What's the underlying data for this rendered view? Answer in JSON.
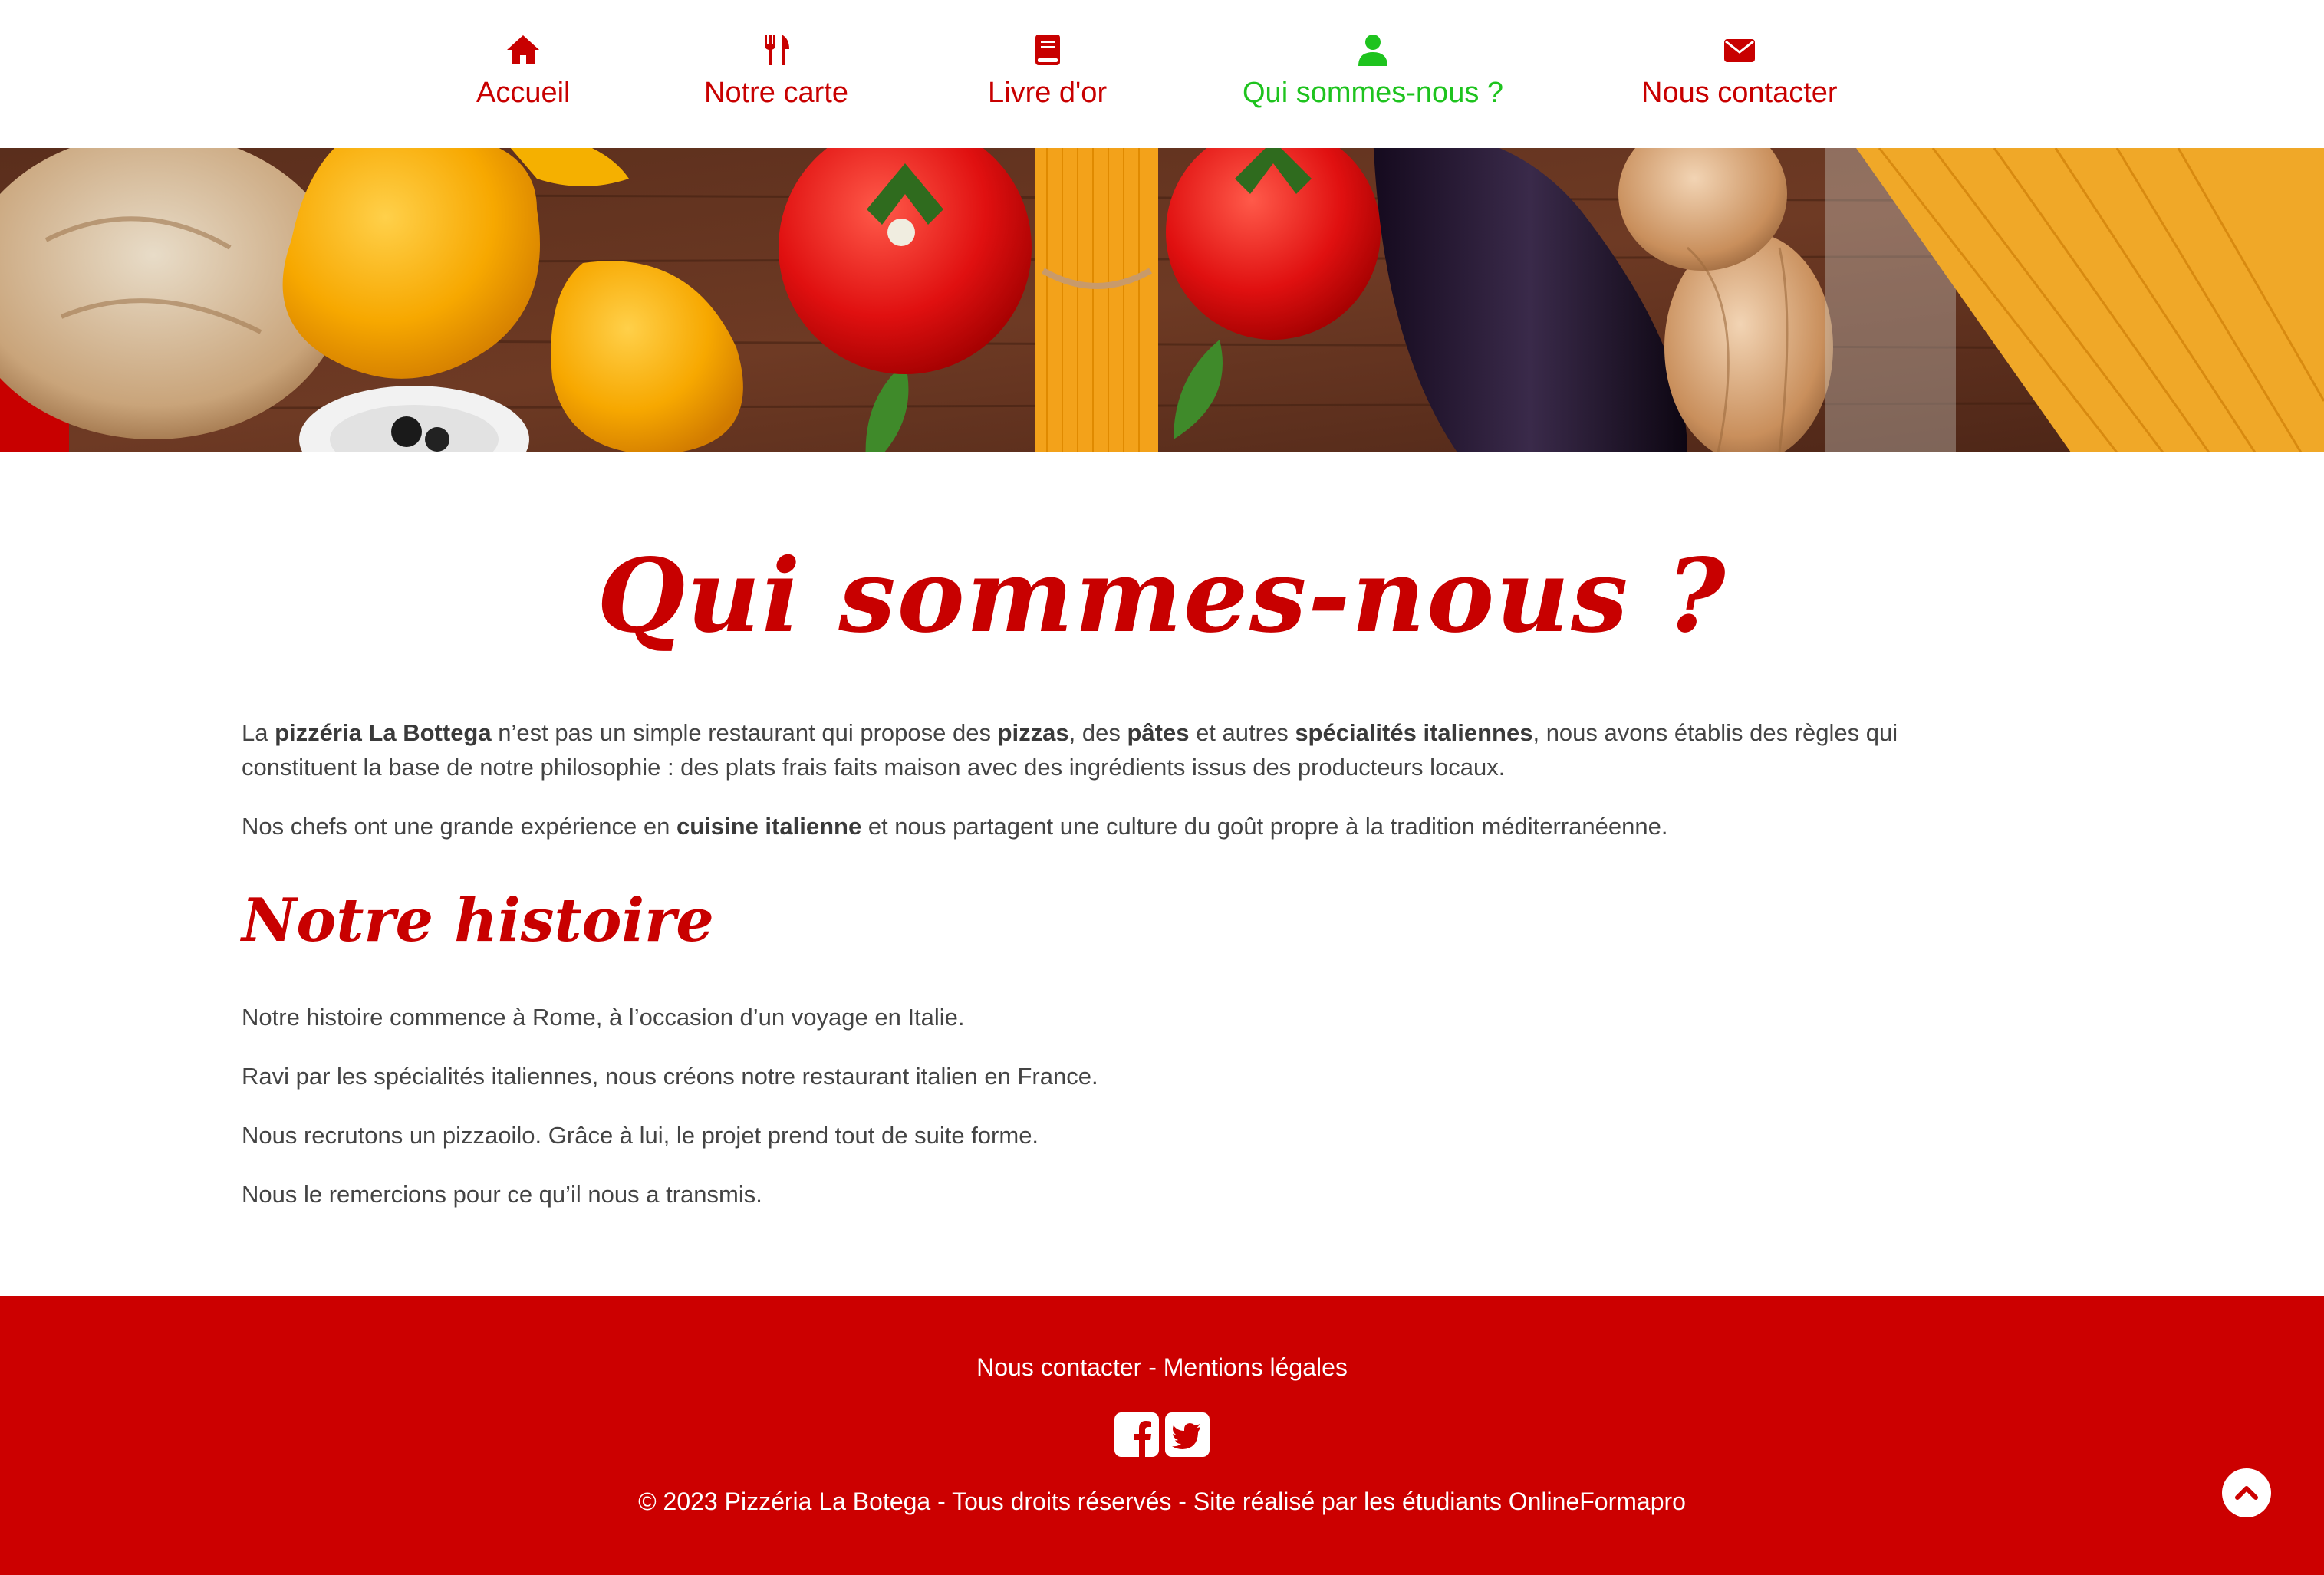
{
  "nav": {
    "items": [
      {
        "label": "Accueil",
        "icon": "home-icon"
      },
      {
        "label": "Notre carte",
        "icon": "utensils-icon"
      },
      {
        "label": "Livre d'or",
        "icon": "book-icon"
      },
      {
        "label": "Qui sommes-nous ?",
        "icon": "user-icon",
        "active": true
      },
      {
        "label": "Nous contacter",
        "icon": "envelope-icon"
      }
    ]
  },
  "main": {
    "title": "Qui sommes-nous ?",
    "intro": {
      "p1": {
        "t1": "La ",
        "b1": "pizzéria La Bottega",
        "t2": " n’est pas un simple restaurant qui propose des ",
        "b2": "pizzas",
        "t3": ", des ",
        "b3": "pâtes",
        "t4": " et autres ",
        "b4": "spécialités italiennes",
        "t5": ", nous avons établis des règles qui constituent la base de notre philosophie : des plats frais faits maison avec des ingrédients issus des producteurs locaux."
      },
      "p2": {
        "t1": "Nos chefs ont une grande expérience en ",
        "b1": "cuisine italienne",
        "t2": " et nous partagent une culture du goût propre à la tradition méditerranéenne."
      }
    },
    "history_title": "Notre histoire",
    "history": [
      "Notre histoire commence à Rome, à l’occasion d’un voyage en Italie.",
      "Ravi par les spécialités italiennes, nous créons notre restaurant italien en France.",
      "Nous recrutons un pizzaoilo. Grâce à lui, le projet prend tout de suite forme.",
      "Nous le remercions pour ce qu’il nous a transmis."
    ]
  },
  "footer": {
    "contact_link": "Nous contacter",
    "separator": " - ",
    "legal_link": "Mentions légales",
    "socials": [
      "facebook-icon",
      "twitter-icon"
    ],
    "copyright": "© 2023 Pizzéria La Botega - Tous droits réservés - Site réalisé par les étudiants OnlineFormapro"
  },
  "colors": {
    "brand_red": "#cc0000",
    "active_green": "#1ec31e",
    "text": "#444444"
  }
}
